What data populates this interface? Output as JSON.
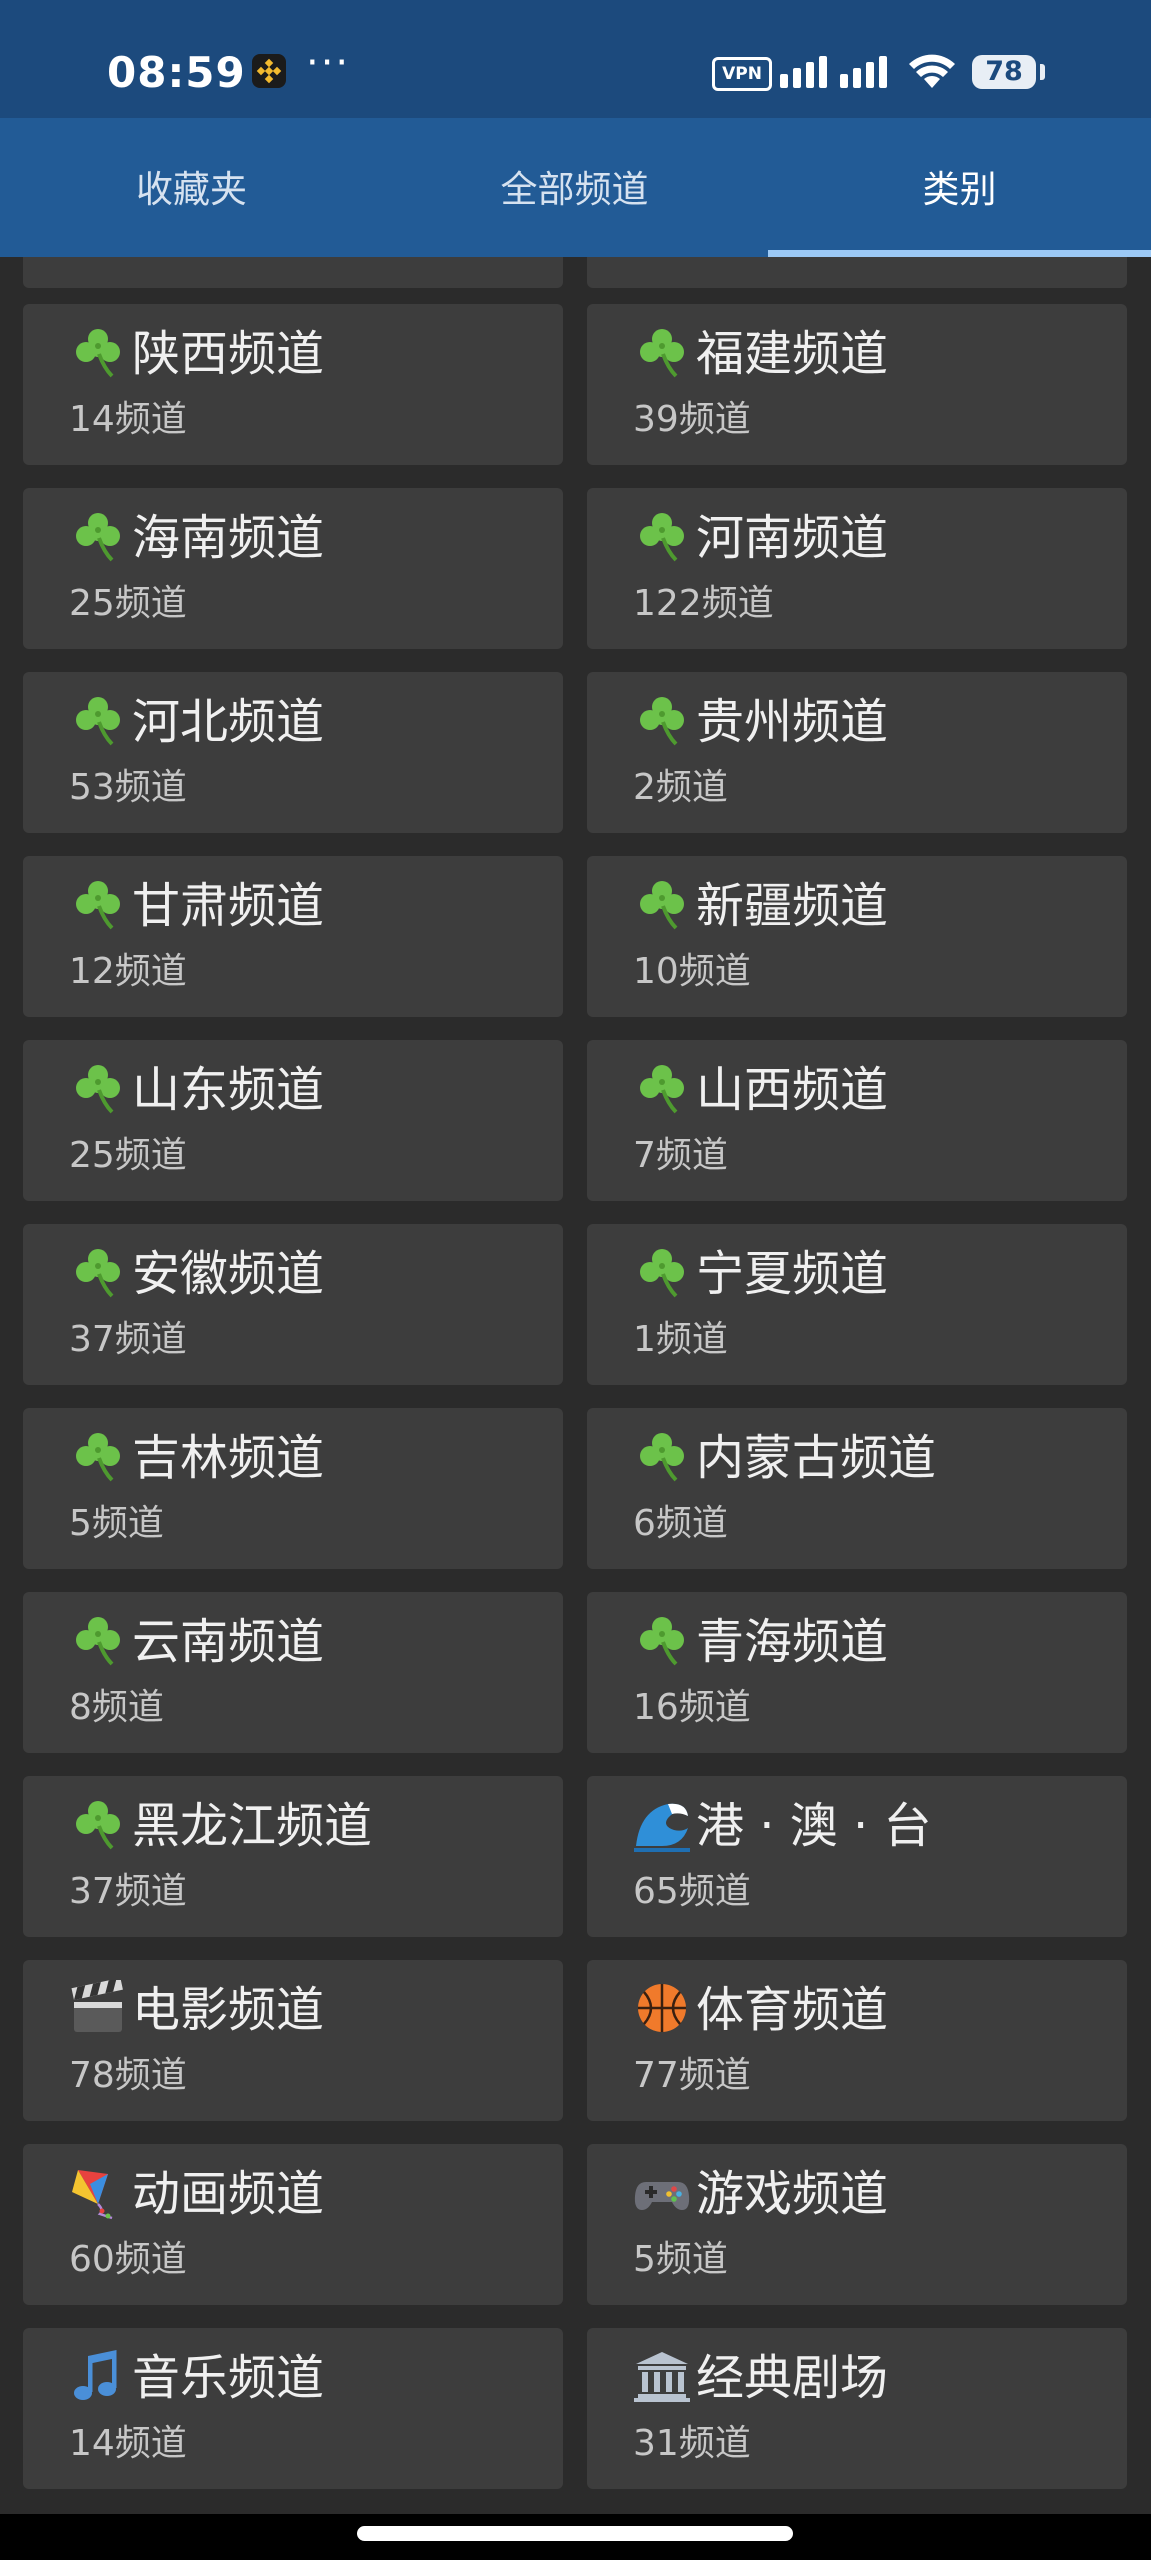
{
  "status_bar": {
    "time": "08:59",
    "app_icon": "binance-icon",
    "more": "···",
    "vpn": "VPN",
    "battery": "78"
  },
  "tabs": [
    {
      "label": "收藏夹",
      "active": false
    },
    {
      "label": "全部频道",
      "active": false
    },
    {
      "label": "类别",
      "active": true
    }
  ],
  "categories": [
    {
      "icon": "clover-icon",
      "name": "陕西频道",
      "count": "14频道"
    },
    {
      "icon": "clover-icon",
      "name": "福建频道",
      "count": "39频道"
    },
    {
      "icon": "clover-icon",
      "name": "海南频道",
      "count": "25频道"
    },
    {
      "icon": "clover-icon",
      "name": "河南频道",
      "count": "122频道"
    },
    {
      "icon": "clover-icon",
      "name": "河北频道",
      "count": "53频道"
    },
    {
      "icon": "clover-icon",
      "name": "贵州频道",
      "count": "2频道"
    },
    {
      "icon": "clover-icon",
      "name": "甘肃频道",
      "count": "12频道"
    },
    {
      "icon": "clover-icon",
      "name": "新疆频道",
      "count": "10频道"
    },
    {
      "icon": "clover-icon",
      "name": "山东频道",
      "count": "25频道"
    },
    {
      "icon": "clover-icon",
      "name": "山西频道",
      "count": "7频道"
    },
    {
      "icon": "clover-icon",
      "name": "安徽频道",
      "count": "37频道"
    },
    {
      "icon": "clover-icon",
      "name": "宁夏频道",
      "count": "1频道"
    },
    {
      "icon": "clover-icon",
      "name": "吉林频道",
      "count": "5频道"
    },
    {
      "icon": "clover-icon",
      "name": "内蒙古频道",
      "count": "6频道"
    },
    {
      "icon": "clover-icon",
      "name": "云南频道",
      "count": "8频道"
    },
    {
      "icon": "clover-icon",
      "name": "青海频道",
      "count": "16频道"
    },
    {
      "icon": "clover-icon",
      "name": "黑龙江频道",
      "count": "37频道"
    },
    {
      "icon": "wave-icon",
      "name": "港 · 澳 · 台",
      "count": "65频道"
    },
    {
      "icon": "clapperboard-icon",
      "name": "电影频道",
      "count": "78频道"
    },
    {
      "icon": "basketball-icon",
      "name": "体育频道",
      "count": "77频道"
    },
    {
      "icon": "kite-icon",
      "name": "动画频道",
      "count": "60频道"
    },
    {
      "icon": "gamepad-icon",
      "name": "游戏频道",
      "count": "5频道"
    },
    {
      "icon": "music-note-icon",
      "name": "音乐频道",
      "count": "14频道"
    },
    {
      "icon": "classical-building-icon",
      "name": "经典剧场",
      "count": "31频道"
    }
  ]
}
